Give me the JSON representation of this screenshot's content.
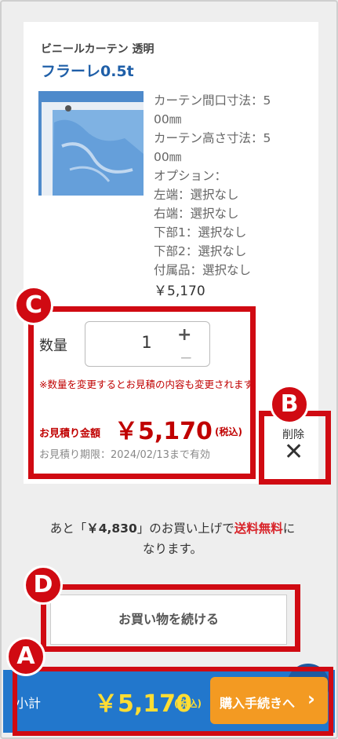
{
  "product": {
    "category": "ビニールカーテン 透明",
    "name": "フラーレ0.5t",
    "specs": [
      "カーテン間口寸法：5",
      "00㎜",
      "カーテン高さ寸法：5",
      "00㎜",
      "オプション：",
      "左端：選択なし",
      "右端：選択なし",
      "下部1：選択なし",
      "下部2：選択なし",
      "付属品：選択なし"
    ],
    "price": "￥5,170"
  },
  "quantity": {
    "label": "数量",
    "value": "1",
    "plus": "+",
    "minus": "−"
  },
  "note": "※数量を変更するとお見積の内容も変更されます。",
  "estimate": {
    "label": "お見積り金額",
    "price": "￥5,170",
    "tax": "(税込)",
    "validity": "お見積り期限：2024/02/13まで有効"
  },
  "delete": {
    "label": "削除",
    "icon": "✕"
  },
  "shipping": {
    "prefix": "あと「",
    "amount": "￥4,830",
    "middle": "」のお買い上げで",
    "free": "送料無料",
    "suffix": "に",
    "line2": "なります。"
  },
  "continue_button": "お買い物を続ける",
  "bottom_bar": {
    "label": "小計",
    "price": "￥5,170",
    "tax": "(税込)",
    "checkout": "購入手続きへ",
    "arrow": "›"
  },
  "annotations": {
    "a": "A",
    "b": "B",
    "c": "C",
    "d": "D"
  },
  "colors": {
    "accent_red": "#d00a12",
    "price_red": "#c00000",
    "bar_blue": "#2277cc",
    "checkout_orange": "#f39a22",
    "price_yellow": "#ffdd33",
    "title_blue": "#1f5fa8"
  }
}
